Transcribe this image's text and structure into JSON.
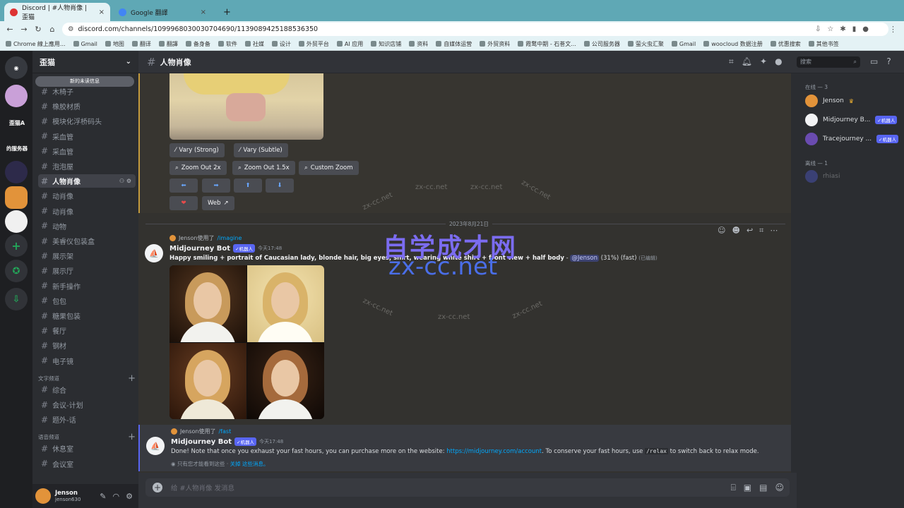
{
  "browser": {
    "tabs": [
      {
        "title": "Discord | #人物肖像 | 歪猫",
        "close": "×"
      },
      {
        "title": "Google 翻譯",
        "close": "×"
      }
    ],
    "new_tab": "+",
    "url": "discord.com/channels/1099968030030704690/1139089425188536350",
    "bookmarks": [
      "Chrome 線上應用...",
      "Gmail",
      "地图",
      "翻译",
      "翻譯",
      "备身备",
      "软件",
      "社媒",
      "设计",
      "外贸平台",
      "AI 应用",
      "知识店铺",
      "资料",
      "自媒体运营",
      "外贸资料",
      "霞鹜中期 - 石巻文...",
      "公司服务器",
      "萤火虫汇聚",
      "Gmail",
      "woocloud 数据注册",
      "优惠搜索",
      "其他书签"
    ]
  },
  "server": {
    "name": "歪猫",
    "new_messages": "新的未读信息",
    "guild_labels": [
      "歪猫A",
      "的服务器"
    ],
    "channels_top": [
      "木椅子",
      "橡胶材质",
      "模块化浮桥码头",
      "采血管",
      "采血管",
      "泡泡屋",
      "人物肖像",
      "动肖像",
      "动肖像",
      "动物",
      "美睿仪包装盒",
      "展示架",
      "展示厅",
      "新手操作",
      "包包",
      "糖果包装",
      "餐厅",
      "钢材",
      "电子镜"
    ],
    "cat_text": "文字频道",
    "channels_text": [
      "综合",
      "会议-计划",
      "题外-话"
    ],
    "cat_voice": "语音频道",
    "channels_voice": [
      "休息室",
      "会议室"
    ]
  },
  "user": {
    "name": "Jenson",
    "tag": "jenson630"
  },
  "header": {
    "channel": "人物肖像",
    "search": "搜索"
  },
  "chat": {
    "buttons_row1": [
      "Vary (Strong)",
      "Vary (Subtle)"
    ],
    "buttons_row2": [
      "Zoom Out 2x",
      "Zoom Out 1.5x",
      "Custom Zoom"
    ],
    "arrows": [
      "⬅",
      "➡",
      "⬆",
      "⬇"
    ],
    "heart": "❤",
    "web": "Web",
    "date": "2023年8月21日",
    "msg1": {
      "reply_user": "Jenson使用了",
      "reply_cmd": "/imagine",
      "bot": "Midjourney Bot",
      "badge": "✓机器人",
      "time": "今天17:48",
      "prompt": "Happy smiling + portrait of Caucasian lady, blonde hair, big eyes, shirt, wearing white shirt + front view + half body",
      "sep": " - ",
      "mention": "@Jenson",
      "status": "(31%) (fast)",
      "edited": "(已编辑)"
    },
    "msg2": {
      "reply_user": "Jenson使用了",
      "reply_cmd": "/fast",
      "bot": "Midjourney Bot",
      "badge": "✓机器人",
      "time": "今天17:48",
      "text1": "Done! Note that once you exhaust your fast hours, you can purchase more on the website: ",
      "link": "https://midjourney.com/account",
      "text2": ". To conserve your fast hours, use ",
      "code": "/relax",
      "text3": " to switch back to relax mode.",
      "ephemeral": "只有您才能看到这些 · ",
      "dismiss": "关掉 这些消息。"
    },
    "placeholder": "给 #人物肖像 发消息"
  },
  "members": {
    "online_label": "在线 — 3",
    "online": [
      {
        "name": "Jenson",
        "crown": "♛"
      },
      {
        "name": "Midjourney B...",
        "badge": "✓机器人"
      },
      {
        "name": "Tracejourney ...",
        "badge": "✓机器人"
      }
    ],
    "offline_label": "离线 — 1",
    "offline": [
      {
        "name": "rhiasi"
      }
    ]
  },
  "watermark": {
    "title": "自学成才网",
    "url": "zx-cc.net",
    "small": "zx-cc.net"
  },
  "colors": {
    "accent": "#5865f2",
    "link": "#00a8fc",
    "highlight": "#c49b3d"
  }
}
